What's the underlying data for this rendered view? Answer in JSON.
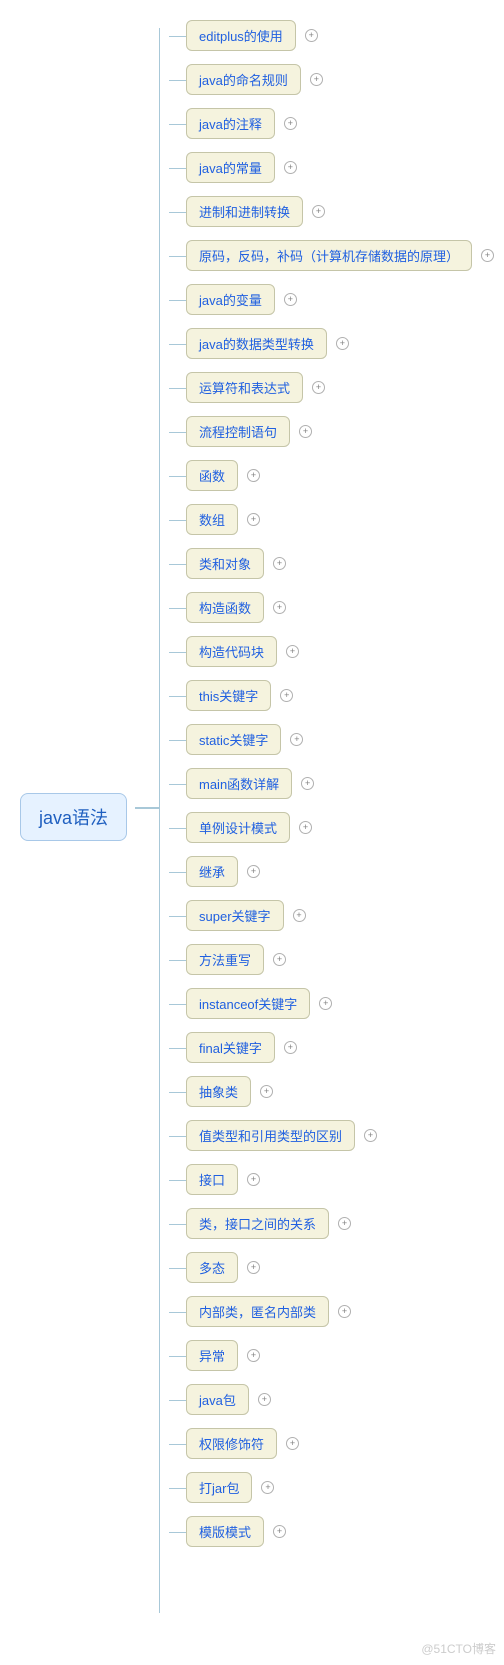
{
  "root": {
    "label": "java语法"
  },
  "children": [
    {
      "label": "editplus的使用"
    },
    {
      "label": "java的命名规则"
    },
    {
      "label": "java的注释"
    },
    {
      "label": "java的常量"
    },
    {
      "label": "进制和进制转换"
    },
    {
      "label": "原码，反码，补码（计算机存储数据的原理）"
    },
    {
      "label": "java的变量"
    },
    {
      "label": "java的数据类型转换"
    },
    {
      "label": "运算符和表达式"
    },
    {
      "label": "流程控制语句"
    },
    {
      "label": "函数"
    },
    {
      "label": "数组"
    },
    {
      "label": "类和对象"
    },
    {
      "label": "构造函数"
    },
    {
      "label": "构造代码块"
    },
    {
      "label": "this关键字"
    },
    {
      "label": "static关键字"
    },
    {
      "label": "main函数详解"
    },
    {
      "label": "单例设计模式"
    },
    {
      "label": "继承"
    },
    {
      "label": "super关键字"
    },
    {
      "label": "方法重写"
    },
    {
      "label": "instanceof关键字"
    },
    {
      "label": "final关键字"
    },
    {
      "label": "抽象类"
    },
    {
      "label": "值类型和引用类型的区别"
    },
    {
      "label": "接口"
    },
    {
      "label": "类，接口之间的关系"
    },
    {
      "label": "多态"
    },
    {
      "label": "内部类，匿名内部类"
    },
    {
      "label": "异常"
    },
    {
      "label": "java包"
    },
    {
      "label": "权限修饰符"
    },
    {
      "label": "打jar包"
    },
    {
      "label": "模版模式"
    }
  ],
  "expand_symbol": "+",
  "watermark": "@51CTO博客"
}
